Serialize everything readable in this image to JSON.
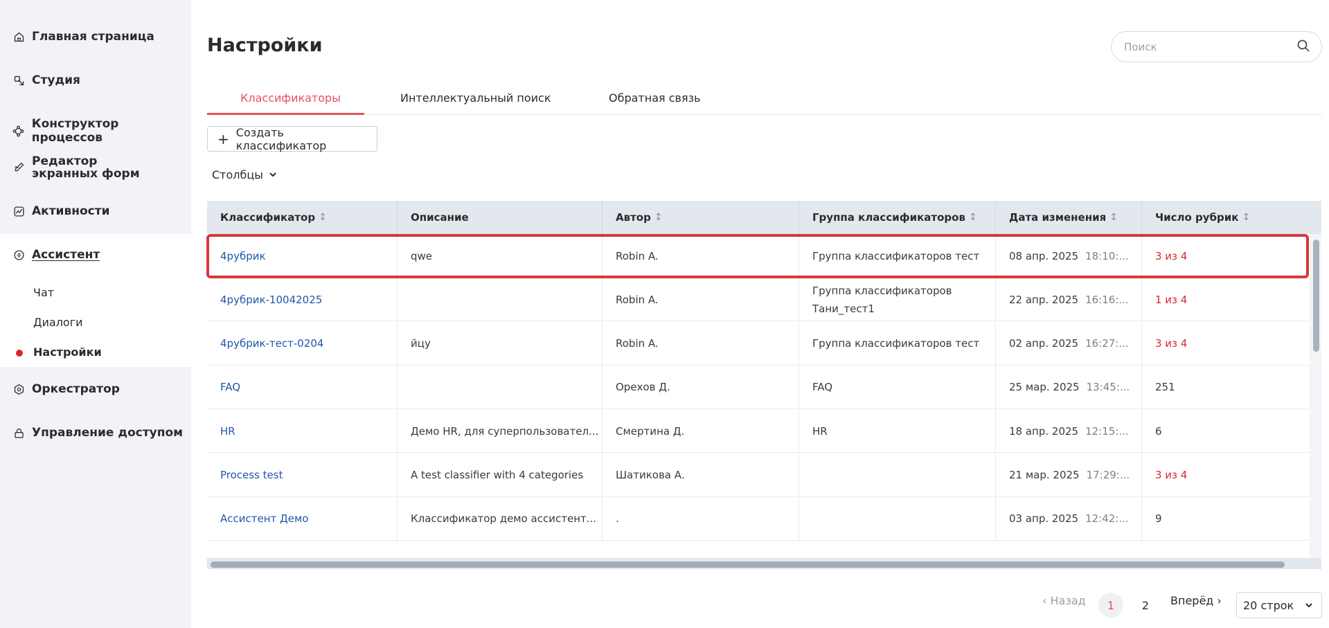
{
  "sidebar": {
    "items": [
      {
        "label": "Главная страница",
        "icon": "home-icon"
      },
      {
        "label": "Студия",
        "icon": "studio-icon"
      },
      {
        "label": "Конструктор процессов",
        "icon": "process-icon"
      },
      {
        "label": "Редактор экранных форм",
        "icon": "form-editor-icon"
      },
      {
        "label": "Активности",
        "icon": "activity-icon"
      },
      {
        "label": "Ассистент",
        "icon": "assistant-icon"
      },
      {
        "label": "Оркестратор",
        "icon": "orchestrator-icon"
      },
      {
        "label": "Управление доступом",
        "icon": "access-icon"
      }
    ],
    "assistant_sub": [
      {
        "label": "Чат"
      },
      {
        "label": "Диалоги"
      },
      {
        "label": "Настройки"
      }
    ]
  },
  "header": {
    "title": "Настройки",
    "search_placeholder": "Поиск"
  },
  "tabs": [
    {
      "label": "Классификаторы"
    },
    {
      "label": "Интеллектуальный поиск"
    },
    {
      "label": "Обратная связь"
    }
  ],
  "toolbar": {
    "create_label": "Создать классификатор",
    "columns_label": "Столбцы"
  },
  "table": {
    "columns": [
      {
        "label": "Классификатор",
        "sortable": true
      },
      {
        "label": "Описание",
        "sortable": false
      },
      {
        "label": "Автор",
        "sortable": true
      },
      {
        "label": "Группа классификаторов",
        "sortable": true
      },
      {
        "label": "Дата изменения",
        "sortable": true
      },
      {
        "label": "Число рубрик",
        "sortable": true
      }
    ],
    "sort_glyph": "↕",
    "rows": [
      {
        "name": "4рубрик",
        "description": "qwe",
        "author": "Robin A.",
        "group": "Группа классификаторов тест",
        "date": "08 апр. 2025",
        "time": "18:10:...",
        "count": "3 из 4",
        "count_alert": true
      },
      {
        "name": "4рубрик-10042025",
        "description": "",
        "author": "Robin A.",
        "group": "Группа классификаторов Тани_тест1",
        "date": "22 апр. 2025",
        "time": "16:16:...",
        "count": "1 из 4",
        "count_alert": true
      },
      {
        "name": "4рубрик-тест-0204",
        "description": "йцу",
        "author": "Robin A.",
        "group": "Группа классификаторов тест",
        "date": "02 апр. 2025",
        "time": "16:27:...",
        "count": "3 из 4",
        "count_alert": true
      },
      {
        "name": "FAQ",
        "description": "",
        "author": "Орехов Д.",
        "group": "FAQ",
        "date": "25 мар. 2025",
        "time": "13:45:...",
        "count": "251",
        "count_alert": false
      },
      {
        "name": "HR",
        "description": "Демо HR, для суперпользовател...",
        "author": "Смертина Д.",
        "group": "HR",
        "date": "18 апр. 2025",
        "time": "12:15:...",
        "count": "6",
        "count_alert": false
      },
      {
        "name": "Process test",
        "description": "A test classifier with 4 categories",
        "author": "Шатикова А.",
        "group": "",
        "date": "21 мар. 2025",
        "time": "17:29:...",
        "count": "3 из 4",
        "count_alert": true
      },
      {
        "name": "Ассистент Демо",
        "description": "Классификатор демо ассистент...",
        "author": ".",
        "group": "",
        "date": "03 апр. 2025",
        "time": "12:42:...",
        "count": "9",
        "count_alert": false
      }
    ]
  },
  "pagination": {
    "prev_label": "‹ Назад",
    "pages": [
      "1",
      "2"
    ],
    "current_page": "1",
    "next_label": "Вперёд ›",
    "rows_per_page": "20 строк"
  },
  "colors": {
    "accent": "#e8505b",
    "link": "#1f57a8",
    "alert": "#d9262e",
    "highlight_border": "#d8373b",
    "sidebar_bg": "#f1f3f6",
    "table_header_bg": "#e3e7ee"
  }
}
